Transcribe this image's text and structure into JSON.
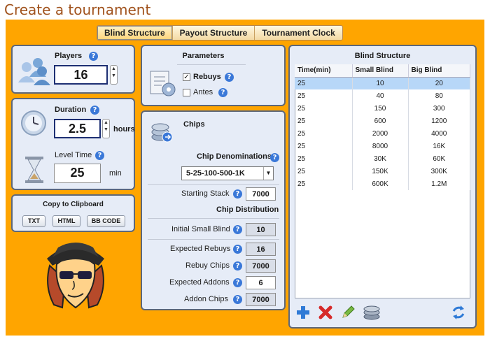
{
  "page_title": "Create a tournament",
  "tabs": [
    {
      "label": "Blind Structure",
      "active": true
    },
    {
      "label": "Payout Structure",
      "active": false
    },
    {
      "label": "Tournament Clock",
      "active": false
    }
  ],
  "players": {
    "label": "Players",
    "value": "16"
  },
  "duration": {
    "label": "Duration",
    "value": "2.5",
    "unit": "hours"
  },
  "level_time": {
    "label": "Level Time",
    "value": "25",
    "unit": "min"
  },
  "clipboard": {
    "title": "Copy to Clipboard",
    "buttons": [
      "TXT",
      "HTML",
      "BB CODE"
    ]
  },
  "parameters": {
    "title": "Parameters",
    "rebuys_label": "Rebuys",
    "rebuys_checked": true,
    "antes_label": "Antes",
    "antes_checked": false
  },
  "chips": {
    "title": "Chips",
    "denominations_label": "Chip Denominations",
    "denominations_value": "5-25-100-500-1K",
    "starting_stack_label": "Starting Stack",
    "starting_stack_value": "7000",
    "distribution_label": "Chip Distribution",
    "initial_small_blind_label": "Initial Small Blind",
    "initial_small_blind_value": "10",
    "expected_rebuys_label": "Expected Rebuys",
    "expected_rebuys_value": "16",
    "rebuy_chips_label": "Rebuy Chips",
    "rebuy_chips_value": "7000",
    "expected_addons_label": "Expected Addons",
    "expected_addons_value": "6",
    "addon_chips_label": "Addon Chips",
    "addon_chips_value": "7000"
  },
  "blind_structure": {
    "title": "Blind Structure",
    "columns": [
      "Time(min)",
      "Small Blind",
      "Big Blind"
    ],
    "rows": [
      [
        "25",
        "10",
        "20"
      ],
      [
        "25",
        "40",
        "80"
      ],
      [
        "25",
        "150",
        "300"
      ],
      [
        "25",
        "600",
        "1200"
      ],
      [
        "25",
        "2000",
        "4000"
      ],
      [
        "25",
        "8000",
        "16K"
      ],
      [
        "25",
        "30K",
        "60K"
      ],
      [
        "25",
        "150K",
        "300K"
      ],
      [
        "25",
        "600K",
        "1.2M"
      ]
    ],
    "selected_row": 0
  },
  "colors": {
    "background": "#ffa500",
    "title": "#a0521d",
    "panel": "#e6ecf7",
    "help": "#3a78d8"
  }
}
